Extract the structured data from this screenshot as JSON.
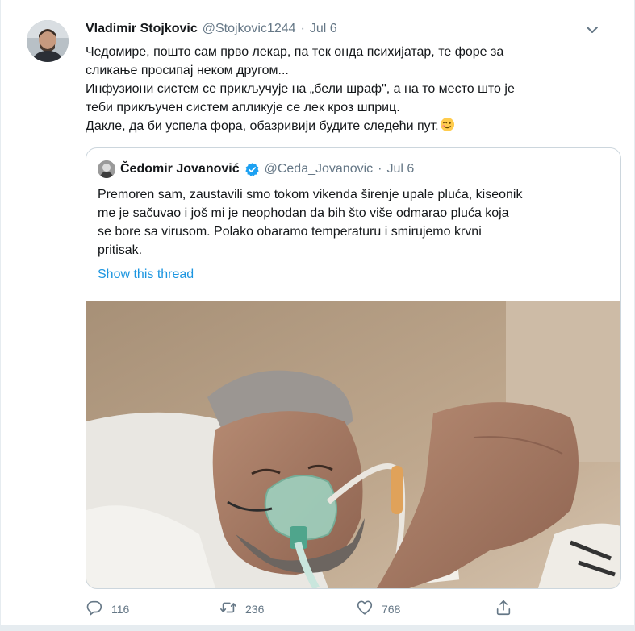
{
  "tweet": {
    "display_name": "Vladimir Stojkovic",
    "handle": "@Stojkovic1244",
    "separator": "·",
    "date": "Jul 6",
    "text_lines": [
      "Чедомире, пошто сам прво лекар, па тек онда психијатар, те форе за",
      "сликање просипај неком другом...",
      "Инфузиони систем се прикључује на „бели шраф\", а на то место што је",
      "теби прикључен систем апликује се лек кроз шприц.",
      "Дакле, да би успела фора, обазривији будите следећи пут."
    ],
    "emoji_icon": "winking-face-icon"
  },
  "quoted_tweet": {
    "display_name": "Čedomir Jovanović",
    "verified_icon": "verified-badge-icon",
    "handle": "@Ceda_Jovanovic",
    "separator": "·",
    "date": "Jul 6",
    "text_lines": [
      "Premoren sam, zaustavili smo tokom vikenda širenje upale pluća, kiseonik",
      "me je sačuvao i još mi je neophodan da bih što više odmarao pluća koja",
      "se bore sa virusom. Polako obaramo temperaturu i smirujemo krvni",
      "pritisak."
    ],
    "show_thread_label": "Show this thread"
  },
  "actions": {
    "reply_count": "116",
    "retweet_count": "236",
    "like_count": "768"
  },
  "colors": {
    "link": "#1b95e0",
    "secondary_text": "#657786",
    "border": "#ccd6dd",
    "verified": "#1da1f2"
  }
}
